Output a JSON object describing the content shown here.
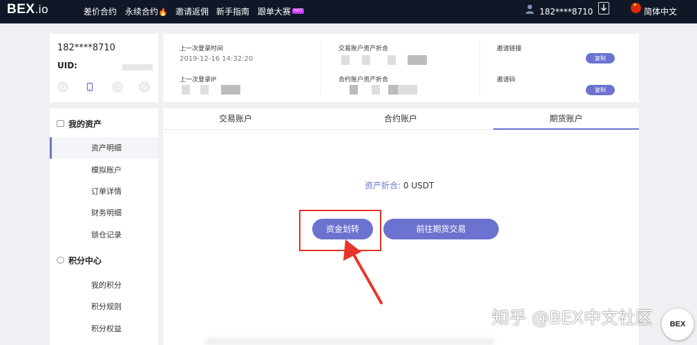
{
  "header": {
    "logo_main": "BEX",
    "logo_suffix": ".io",
    "nav": [
      "差价合约",
      "永续合约",
      "邀请返佣",
      "新手指南",
      "跟单大赛"
    ],
    "hot_badge": "HOT",
    "user_phone": "182****8710",
    "language": "简体中文"
  },
  "profile": {
    "phone": "182****8710",
    "uid_label": "UID:",
    "binding_icons": [
      "email-icon",
      "phone-icon",
      "card-icon",
      "google-icon"
    ]
  },
  "info": {
    "last_login_time_label": "上一次登录时间",
    "last_login_time": "2019-12-16 14:32:20",
    "last_login_ip_label": "上一次登录IP",
    "trade_assets_label": "交易账户资产折合",
    "contract_assets_label": "合约账户资产折合",
    "invite_link_label": "邀请链接",
    "invite_code_label": "邀请码",
    "copy_label": "复制"
  },
  "sidebar": {
    "sections": [
      {
        "title": "我的资产",
        "items": [
          "资产明细",
          "模拟账户",
          "订单详情",
          "财务明细",
          "锁仓记录"
        ]
      },
      {
        "title": "积分中心",
        "items": [
          "我的积分",
          "积分规则",
          "积分权益"
        ]
      }
    ],
    "active_item": "资产明细"
  },
  "main": {
    "tabs": [
      "交易账户",
      "合约账户",
      "期货账户"
    ],
    "active_tab": "期货账户",
    "total_label": "资产折合:",
    "total_value": "0 USDT",
    "transfer_button": "资金划转",
    "goto_button": "前往期货交易"
  },
  "watermark": "知乎 @BEX中文社区",
  "float_logo": "BEX",
  "colors": {
    "accent": "#6b72cf",
    "nav_bg": "#101828",
    "highlight": "#e03424",
    "flame": "#ff5a36"
  }
}
